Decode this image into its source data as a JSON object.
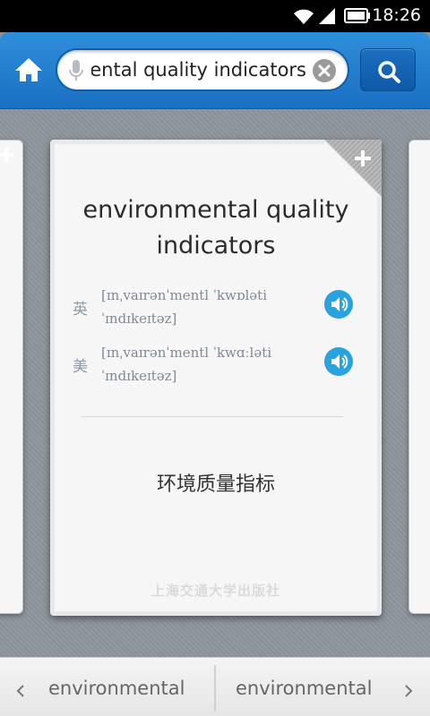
{
  "status_bar": {
    "time": "18:26"
  },
  "search": {
    "query": "environmental quality indicators"
  },
  "card": {
    "headword": "environmental quality indicators",
    "pronunciations": [
      {
        "region": "英",
        "ipa": "[ɪnˌvaɪrənˈmentl ˈkwɒləti ˈɪndɪkeɪtəz]"
      },
      {
        "region": "美",
        "ipa": "[ɪnˌvaɪrənˈmentl ˈkwɑːləti ˈɪndɪkeɪtəz]"
      }
    ],
    "translation": "环境质量指标",
    "publisher": "上海交通大学出版社"
  },
  "bottom_nav": {
    "prev_label": "environmental",
    "next_label": "environmental"
  },
  "colors": {
    "accent": "#1f7dd0",
    "speaker": "#29a3e0"
  }
}
